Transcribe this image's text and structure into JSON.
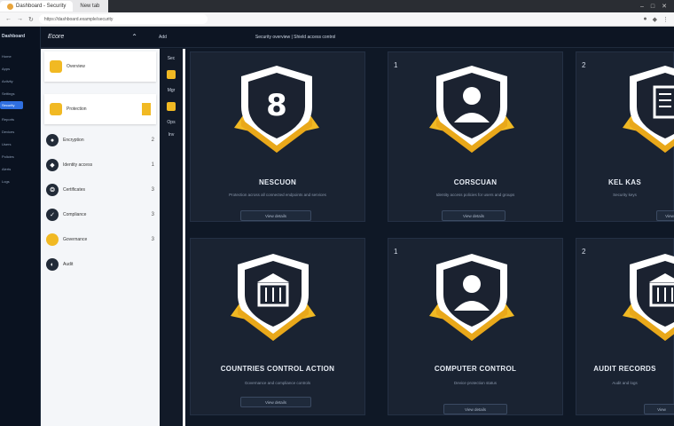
{
  "browser": {
    "tab_active": "Dashboard - Security",
    "tab_2": "New tab",
    "url": "https://dashboard.example/security"
  },
  "rail": {
    "brand": "Dashboard",
    "items": [
      "Home",
      "Apps",
      "Activity",
      "Settings",
      "Security",
      "Reports",
      "Devices",
      "Users",
      "Policies",
      "Alerts",
      "Logs"
    ]
  },
  "topbar": {
    "logo": "Ecore",
    "label": "Add",
    "center": "Security overview | Shield access control"
  },
  "panel": {
    "items": [
      {
        "label": "Overview",
        "count": ""
      },
      {
        "label": "Protection",
        "count": ""
      },
      {
        "label": "Encryption",
        "count": "2"
      },
      {
        "label": "Identity access",
        "count": "1"
      },
      {
        "label": "Certificates",
        "count": "3"
      },
      {
        "label": "Compliance",
        "count": "3"
      },
      {
        "label": "Governance",
        "count": "3"
      },
      {
        "label": "Audit",
        "count": ""
      }
    ]
  },
  "iconcol": {
    "labels": [
      "Sec",
      "Mgr",
      "Ops",
      "Inv"
    ]
  },
  "cards": [
    {
      "num": "",
      "title": "NESCUON",
      "sub": "Protection across all connected endpoints and services",
      "btn": "View details"
    },
    {
      "num": "1",
      "title": "CORSCUAN",
      "sub": "Identity access policies for users and groups",
      "btn": "View details"
    },
    {
      "num": "2",
      "title": "KEL KAS",
      "sub": "Security keys",
      "btn": "View"
    },
    {
      "num": "",
      "title": "COUNTRIES CONTROL ACTION",
      "sub": "Governance and compliance controls",
      "btn": "View details"
    },
    {
      "num": "1",
      "title": "COMPUTER CONTROL",
      "sub": "Device protection status",
      "btn": "View details"
    },
    {
      "num": "2",
      "title": "AUDIT RECORDS",
      "sub": "Audit and logs",
      "btn": "View"
    }
  ],
  "colors": {
    "accent_gold": "#f1b923",
    "card_bg": "#1a2332",
    "shield_white": "#ffffff",
    "shield_dark": "#1b2230"
  },
  "icons": {
    "shield": "shield-icon",
    "badge": "ribbon-icon"
  }
}
